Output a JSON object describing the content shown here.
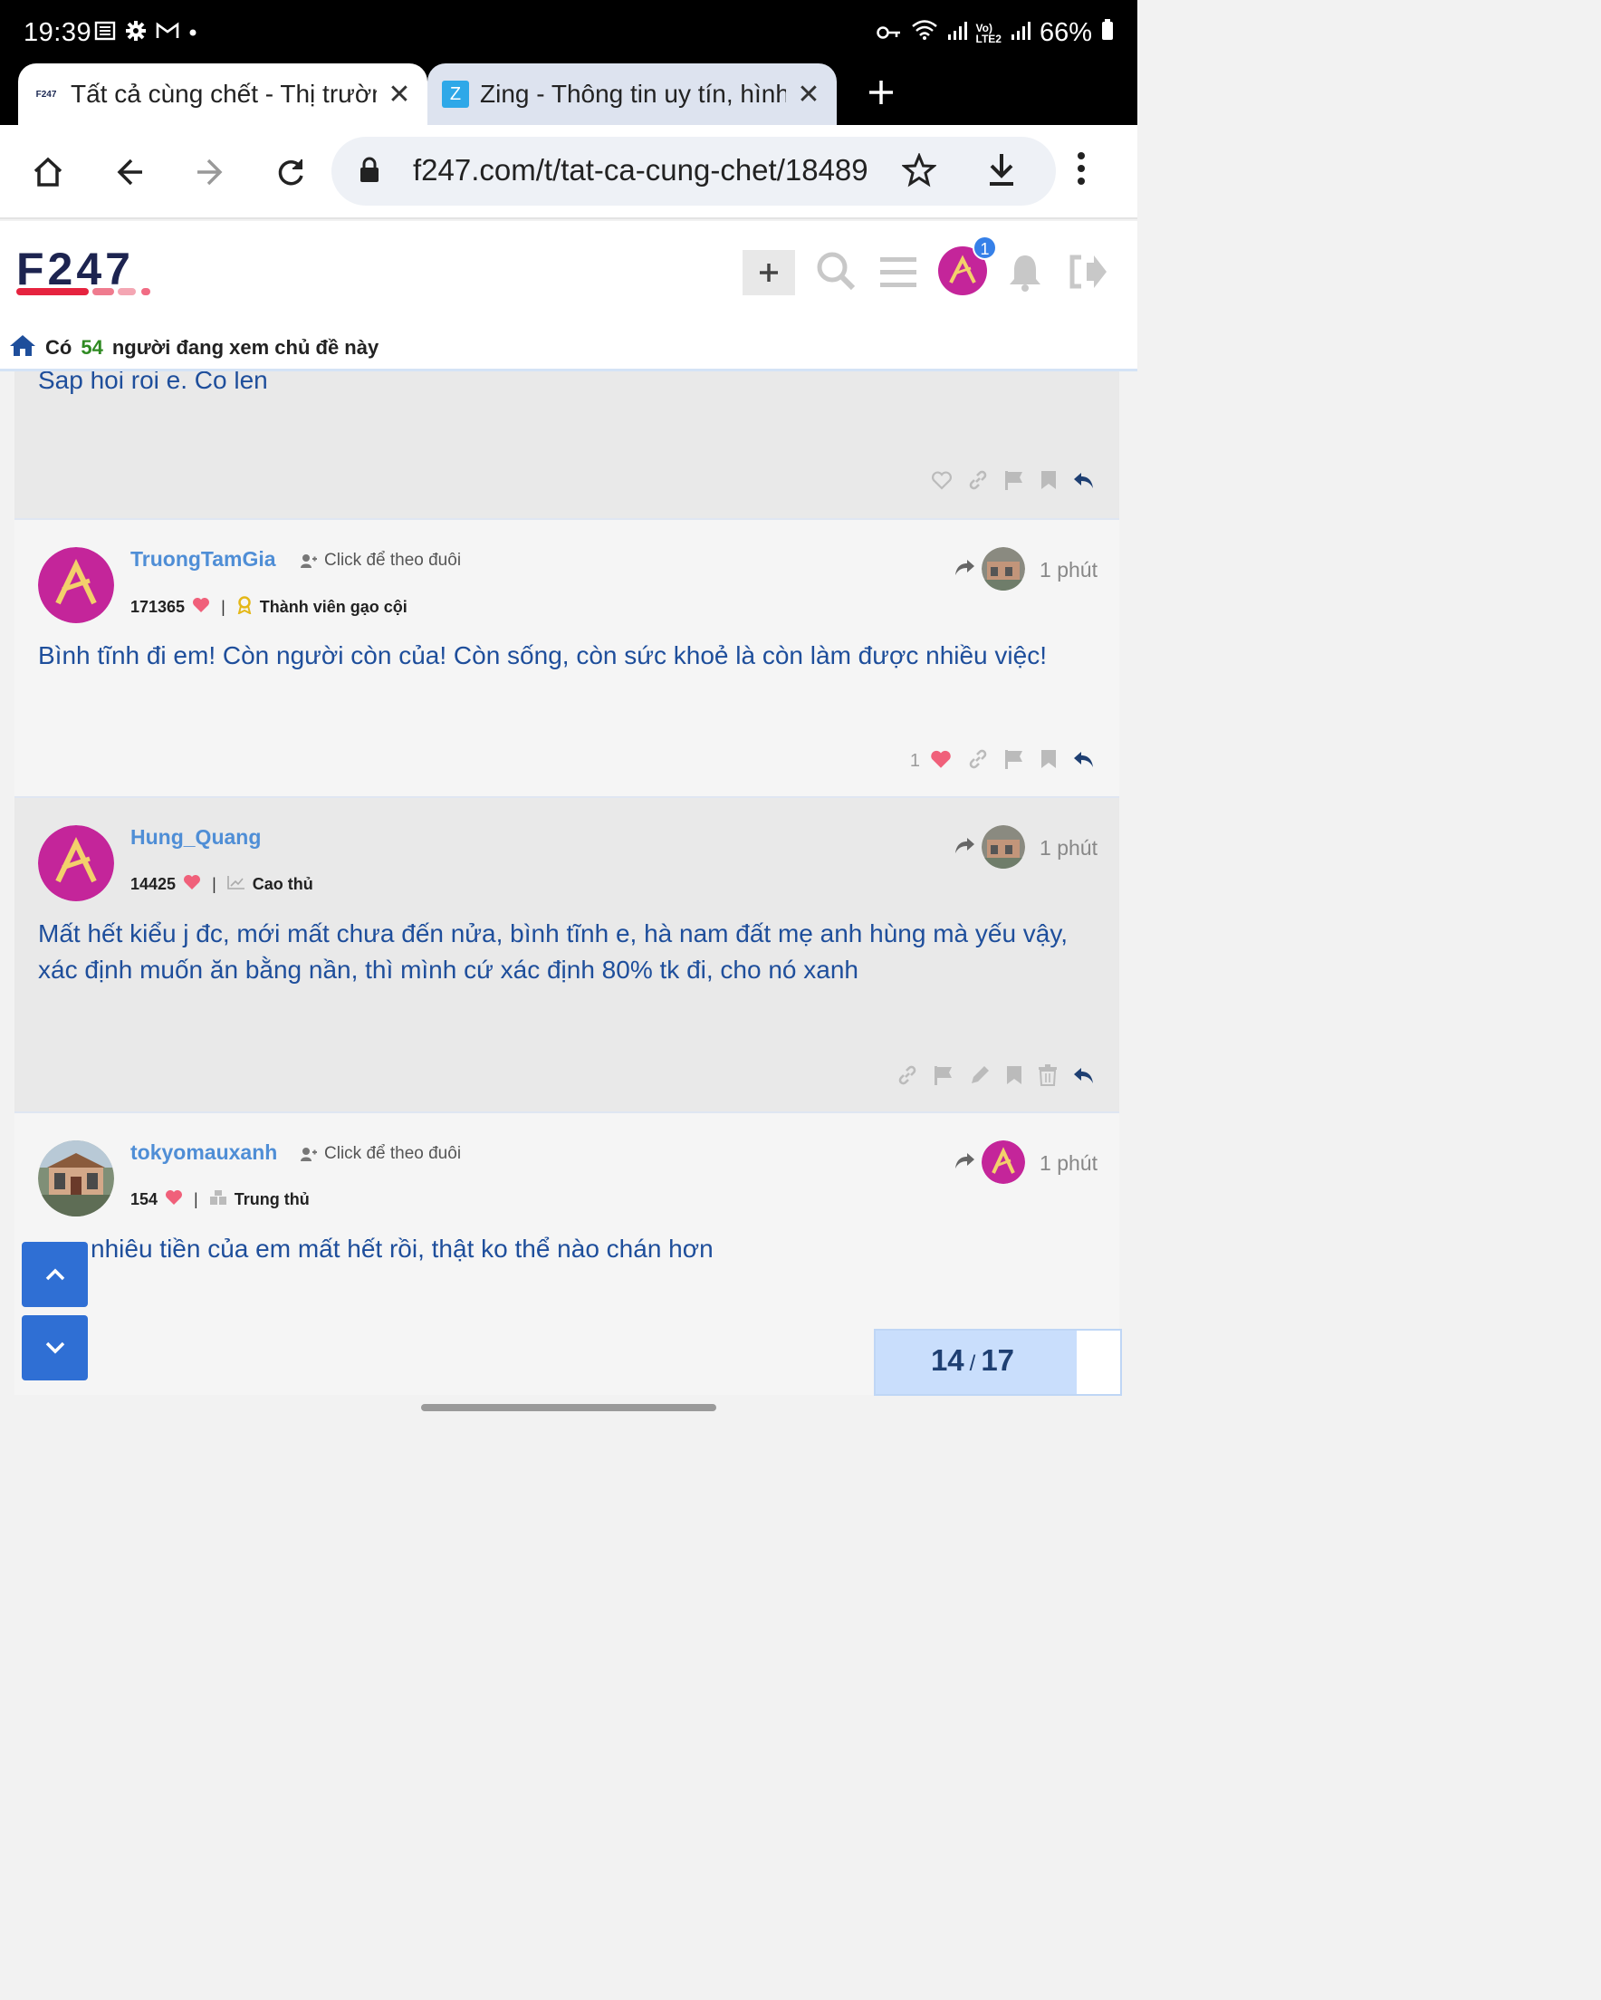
{
  "status_bar": {
    "time": "19:39",
    "battery": "66%"
  },
  "tabs": [
    {
      "title": "Tất cả cùng chết - Thị trường chứng khoán",
      "favicon_text": "F247"
    },
    {
      "title": "Zing - Thông tin uy tín, hình ảnh",
      "favicon_text": "Z"
    }
  ],
  "toolbar": {
    "url": "f247.com/t/tat-ca-cung-chet/18489"
  },
  "header": {
    "logo_text": "F247",
    "notification_count": "1",
    "viewers_prefix": "Có",
    "viewers_count": "54",
    "viewers_suffix": "người đang xem chủ đề này"
  },
  "posts": [
    {
      "partial_text": "Sap hoi roi e. Co len"
    },
    {
      "username": "TruongTamGia",
      "follow_label": "Click để theo đuôi",
      "score": "171365",
      "rank": "Thành viên gạo cội",
      "rank_icon": "medal-icon",
      "time": "1 phút",
      "text": "Bình tĩnh đi em! Còn người còn của! Còn sống, còn sức khoẻ là còn làm được nhiều việc!",
      "likes": "1"
    },
    {
      "username": "Hung_Quang",
      "score": "14425",
      "rank": "Cao thủ",
      "rank_icon": "chart-icon",
      "time": "1 phút",
      "text": "Mất hết kiểu j đc, mới mất chưa đến nửa, bình tĩnh e, hà nam đất mẹ anh hùng mà yếu vậy, xác định muốn ăn bằng nần, thì mình cứ xác định 80% tk đi, cho nó xanh"
    },
    {
      "username": "tokyomauxanh",
      "follow_label": "Click để theo đuôi",
      "score": "154",
      "rank": "Trung thủ",
      "rank_icon": "blocks-icon",
      "time": "1 phút",
      "text": "nhiêu tiền của em mất hết rồi, thật ko thể nào chán hơn"
    }
  ],
  "progress": {
    "current": "14",
    "total": "17",
    "fraction": 0.8235
  },
  "colors": {
    "accent_blue": "#2f6fd4",
    "username_blue": "#4f8ed6",
    "text_blue": "#1e4e9b",
    "heart_pink": "#f0607a",
    "avatar_magenta": "#c4259a"
  }
}
